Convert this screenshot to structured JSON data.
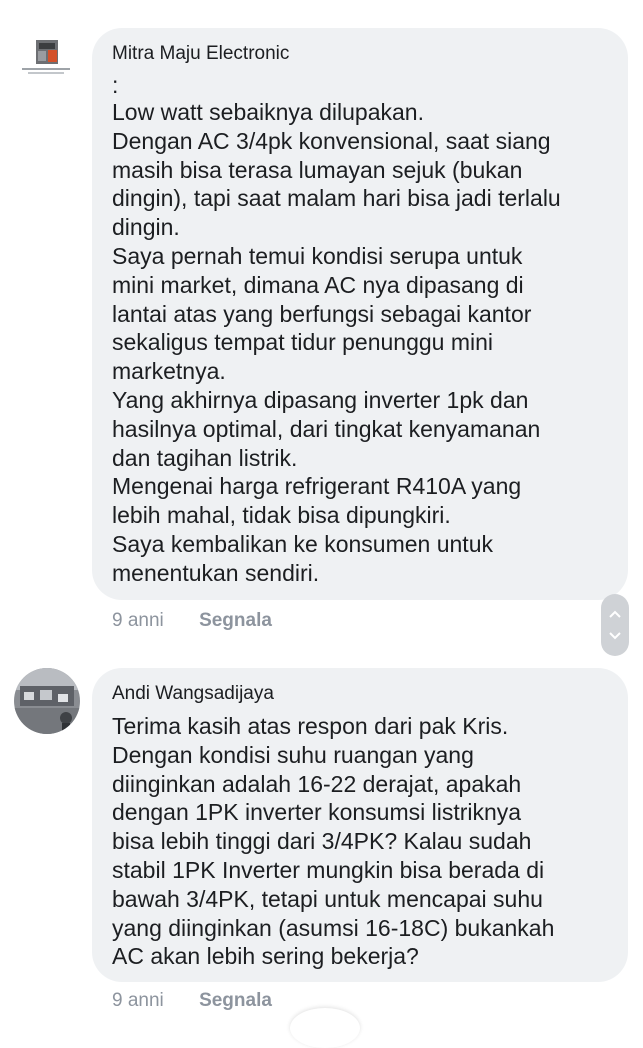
{
  "comments": [
    {
      "author": "Mitra Maju Electronic",
      "lines": [
        ":",
        "Low watt sebaiknya dilupakan.",
        "Dengan AC 3/4pk konvensional, saat siang",
        "masih bisa terasa lumayan sejuk (bukan",
        "dingin), tapi saat malam hari bisa jadi terlalu",
        "dingin.",
        "Saya pernah temui kondisi serupa untuk",
        "mini market, dimana AC nya dipasang di",
        "lantai atas yang berfungsi sebagai kantor",
        "sekaligus tempat tidur penunggu mini",
        "marketnya.",
        "Yang akhirnya dipasang inverter 1pk dan",
        "hasilnya optimal, dari tingkat kenyamanan",
        "dan tagihan listrik.",
        "Mengenai harga refrigerant R410A yang",
        "lebih mahal, tidak bisa dipungkiri.",
        "Saya kembalikan ke konsumen untuk",
        "menentukan sendiri."
      ],
      "time": "9 anni",
      "report_label": "Segnala"
    },
    {
      "author": "Andi Wangsadijaya",
      "lines": [
        "Terima kasih atas respon dari pak Kris.",
        "Dengan kondisi suhu ruangan yang",
        "diinginkan adalah 16-22 derajat, apakah",
        "dengan 1PK inverter konsumsi listriknya",
        "bisa lebih tinggi dari 3/4PK? Kalau sudah",
        "stabil 1PK Inverter mungkin bisa berada di",
        "bawah 3/4PK, tetapi untuk mencapai suhu",
        "yang diinginkan (asumsi 16-18C) bukankah",
        "AC akan lebih sering bekerja?"
      ],
      "time": "9 anni",
      "report_label": "Segnala"
    }
  ],
  "icons": {
    "scroll_up": "chevron-up-icon",
    "scroll_down": "chevron-down-icon"
  },
  "colors": {
    "bubble": "#eff1f3",
    "meta_text": "#8d949e",
    "text": "#1c1e21"
  }
}
